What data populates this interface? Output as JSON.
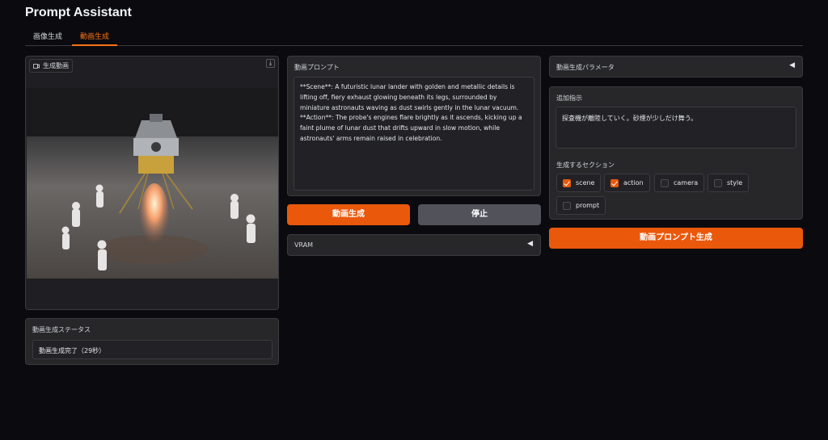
{
  "app": {
    "title": "Prompt Assistant"
  },
  "tabs": [
    {
      "label": "画像生成",
      "active": false
    },
    {
      "label": "動画生成",
      "active": true
    }
  ],
  "video": {
    "label": "生成動画",
    "download_icon": "download-icon"
  },
  "status": {
    "label": "動画生成ステータス",
    "value": "動画生成完了（29秒）"
  },
  "prompt": {
    "label": "動画プロンプト",
    "value": "**Scene**: A futuristic lunar lander with golden and metallic details is lifting off, fiery exhaust glowing beneath its legs, surrounded by miniature astronauts waving as dust swirls gently in the lunar vacuum.\n**Action**: The probe's engines flare brightly as it ascends, kicking up a faint plume of lunar dust that drifts upward in slow motion, while astronauts' arms remain raised in celebration."
  },
  "buttons": {
    "generate": "動画生成",
    "stop": "停止",
    "prompt_generate": "動画プロンプト生成"
  },
  "vram": {
    "label": "VRAM",
    "arrow": "◀"
  },
  "params": {
    "label": "動画生成パラメータ",
    "arrow": "◀"
  },
  "instructions": {
    "label": "追加指示",
    "value": "探査機が離陸していく。砂煙が少しだけ舞う。"
  },
  "sections": {
    "label": "生成するセクション",
    "items": [
      {
        "label": "scene",
        "checked": true
      },
      {
        "label": "action",
        "checked": true
      },
      {
        "label": "camera",
        "checked": false
      },
      {
        "label": "style",
        "checked": false
      },
      {
        "label": "prompt",
        "checked": false
      }
    ]
  },
  "colors": {
    "accent": "#ea580c",
    "background": "#0b0b0f",
    "panel": "#27272a"
  }
}
